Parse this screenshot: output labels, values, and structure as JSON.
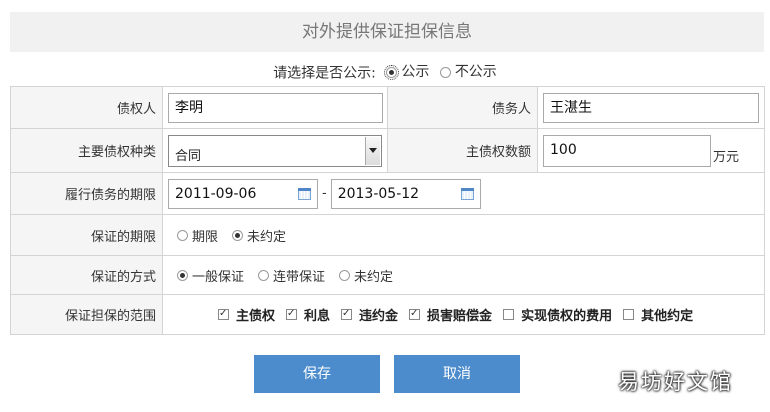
{
  "title": "对外提供保证担保信息",
  "publicity": {
    "question": "请选择是否公示:",
    "options": [
      "公示",
      "不公示"
    ],
    "selected": "公示"
  },
  "creditor": {
    "label": "债权人",
    "value": "李明"
  },
  "debtor": {
    "label": "债务人",
    "value": "王湛生"
  },
  "claim_type": {
    "label": "主要债权种类",
    "value": "合同"
  },
  "claim_amount": {
    "label": "主债权数额",
    "value": "100",
    "unit": "万元"
  },
  "period": {
    "label": "履行债务的期限",
    "start": "2011-09-06",
    "separator": "-",
    "end": "2013-05-12"
  },
  "guarantee_period": {
    "label": "保证的期限",
    "options": [
      "期限",
      "未约定"
    ],
    "selected": "未约定"
  },
  "guarantee_method": {
    "label": "保证的方式",
    "options": [
      "一般保证",
      "连带保证",
      "未约定"
    ],
    "selected": "一般保证"
  },
  "scope": {
    "label": "保证担保的范围",
    "items": [
      {
        "label": "主债权",
        "checked": true
      },
      {
        "label": "利息",
        "checked": true
      },
      {
        "label": "违约金",
        "checked": true
      },
      {
        "label": "损害赔偿金",
        "checked": true
      },
      {
        "label": "实现债权的费用",
        "checked": false
      },
      {
        "label": "其他约定",
        "checked": false
      }
    ]
  },
  "buttons": {
    "save": "保存",
    "cancel": "取消"
  },
  "watermark": "易坊好文馆",
  "colors": {
    "button": "#4d8ccc",
    "title_bg": "#f1f1f1",
    "label_bg": "#f5f5f5"
  },
  "icons": {
    "date_picker": "calendar-icon",
    "dropdown": "chevron-down-icon"
  }
}
